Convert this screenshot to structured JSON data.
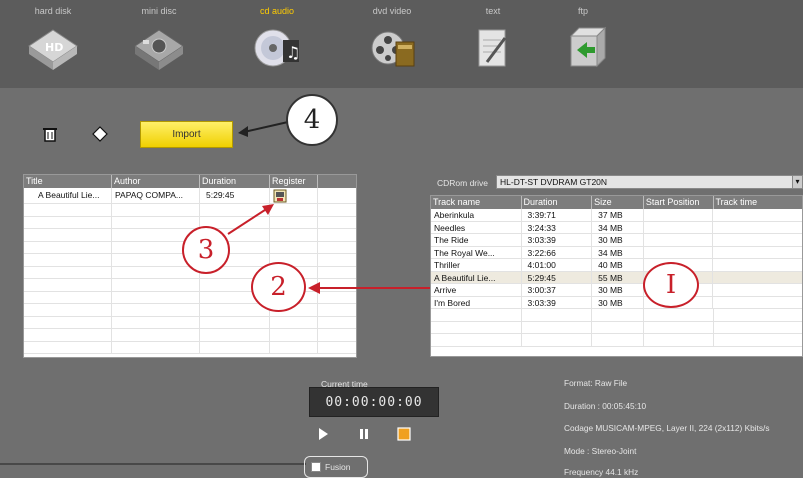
{
  "sources": [
    {
      "label": "hard disk",
      "icon": "hard-disk-icon"
    },
    {
      "label": "mini disc",
      "icon": "mini-disc-icon"
    },
    {
      "label": "cd audio",
      "icon": "cd-audio-icon"
    },
    {
      "label": "dvd video",
      "icon": "dvd-video-icon"
    },
    {
      "label": "text",
      "icon": "text-icon"
    },
    {
      "label": "ftp",
      "icon": "ftp-icon"
    }
  ],
  "active_source": "cd audio",
  "toolbar": {
    "import_label": "Import"
  },
  "playlist": {
    "columns": [
      "Title",
      "Author",
      "Duration",
      "Register"
    ],
    "rows": [
      {
        "title": "A Beautiful Lie...",
        "author": "PAPAQ COMPA...",
        "duration": "5:29:45",
        "register": "register-icon"
      }
    ]
  },
  "cdrom": {
    "label": "CDRom drive",
    "drive": "HL-DT-ST DVDRAM GT20N",
    "columns": [
      "Track name",
      "Duration",
      "Size",
      "Start Position",
      "Track time"
    ],
    "rows": [
      {
        "name": "Aberinkula",
        "duration": "3:39:71",
        "size": "37 MB"
      },
      {
        "name": "Needles",
        "duration": "3:24:33",
        "size": "34 MB"
      },
      {
        "name": "The Ride",
        "duration": "3:03:39",
        "size": "30 MB"
      },
      {
        "name": "The Royal We...",
        "duration": "3:22:66",
        "size": "34 MB"
      },
      {
        "name": "Thriller",
        "duration": "4:01:00",
        "size": "40 MB"
      },
      {
        "name": "A Beautiful Lie...",
        "duration": "5:29:45",
        "size": "55 MB"
      },
      {
        "name": "Arrive",
        "duration": "3:00:37",
        "size": "30 MB"
      },
      {
        "name": "I'm Bored",
        "duration": "3:03:39",
        "size": "30 MB"
      }
    ],
    "selected_index": 5
  },
  "player": {
    "current_time_label": "Current time",
    "current_time": "00:00:00:00",
    "fusion_label": "Fusion"
  },
  "info": {
    "format": "Format: Raw File",
    "duration": "Duration : 00:05:45:10",
    "codec": "Codage MUSICAM-MPEG, Layer II, 224 (2x112) Kbits/s",
    "mode": "Mode : Stereo-Joint",
    "frequency": "Frequency 44.1 kHz"
  },
  "callouts": [
    "4",
    "3",
    "2",
    "I"
  ],
  "colors": {
    "accent": "#ffcc00",
    "callout_red": "#c8202a",
    "selected_row": "#eeeadf",
    "import_button": "#f5dc20"
  }
}
